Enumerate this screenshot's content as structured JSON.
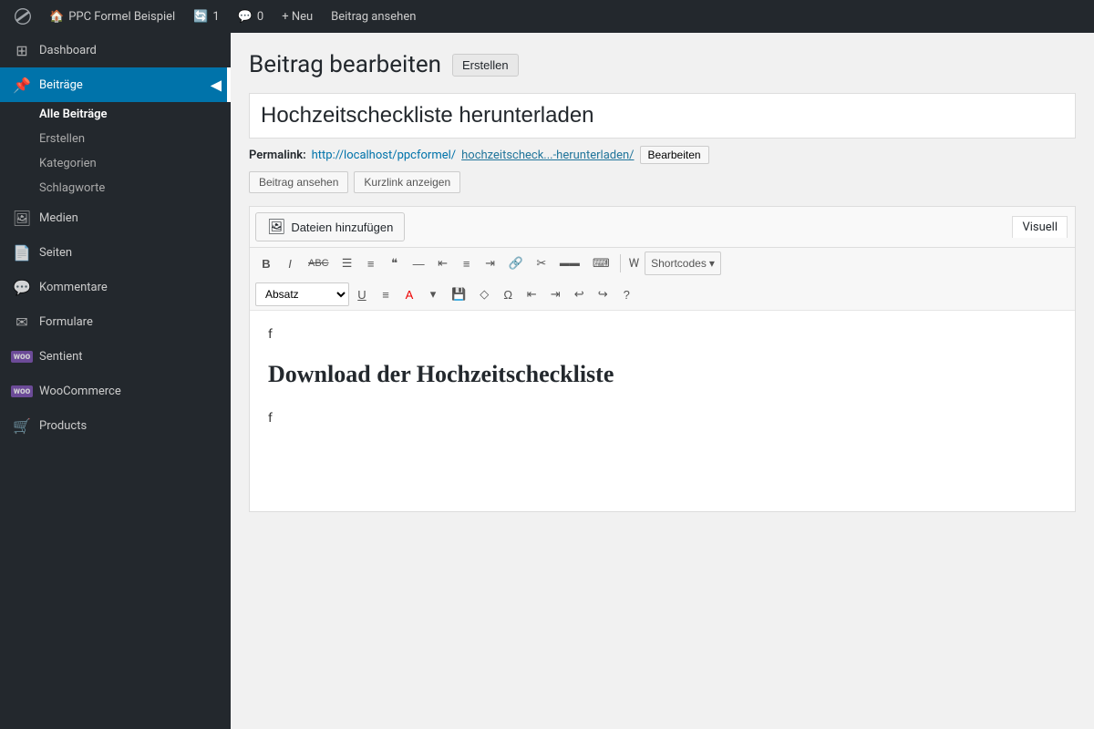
{
  "adminbar": {
    "site_name": "PPC Formel Beispiel",
    "updates_count": "1",
    "comments_count": "0",
    "new_label": "+ Neu",
    "view_post_label": "Beitrag ansehen"
  },
  "sidebar": {
    "dashboard_label": "Dashboard",
    "beitraege_label": "Beiträge",
    "sub_items": [
      {
        "label": "Alle Beiträge",
        "active": true
      },
      {
        "label": "Erstellen",
        "active": false
      },
      {
        "label": "Kategorien",
        "active": false
      },
      {
        "label": "Schlagworte",
        "active": false
      }
    ],
    "medien_label": "Medien",
    "seiten_label": "Seiten",
    "kommentare_label": "Kommentare",
    "formulare_label": "Formulare",
    "sentient_label": "Sentient",
    "woocommerce_label": "WooCommerce",
    "products_label": "Products"
  },
  "page": {
    "title": "Beitrag bearbeiten",
    "erstellen_label": "Erstellen",
    "post_title": "Hochzeitscheckliste herunterladen",
    "permalink_label": "Permalink:",
    "permalink_base": "http://localhost/ppcformel/",
    "permalink_slug": "hochzeitscheck...-herunterladen/",
    "bearbeiten_label": "Bearbeiten",
    "btn_beitrag_ansehen": "Beitrag ansehen",
    "btn_kurzlink": "Kurzlink anzeigen"
  },
  "toolbar": {
    "add_media_label": "Dateien hinzufügen",
    "visuell_label": "Visuell",
    "paragraph_label": "Absatz",
    "shortcodes_label": "Shortcodes",
    "buttons": {
      "bold": "B",
      "italic": "I",
      "strike": "ABC",
      "ul": "≡",
      "ol": "≡",
      "quote": "❝",
      "dash": "—",
      "align_left": "≡",
      "align_center": "≡",
      "align_right": "≡",
      "link": "🔗",
      "unlink": "✂",
      "more": "⋯",
      "keyboard": "⌨",
      "underline": "U",
      "justify": "≡",
      "color": "A",
      "save": "💾",
      "erase": "◇",
      "omega": "Ω",
      "indent_out": "⇤",
      "indent_in": "⇥",
      "undo": "↩",
      "redo": "↪",
      "help": "?"
    }
  },
  "editor": {
    "content_line1": "f",
    "content_heading": "Download der Hochzeitscheckliste",
    "content_line2": "f"
  },
  "colors": {
    "adminbar_bg": "#23282d",
    "sidebar_bg": "#23282d",
    "active_menu": "#0073aa",
    "accent": "#0073aa",
    "woo_purple": "#7f54b3"
  }
}
